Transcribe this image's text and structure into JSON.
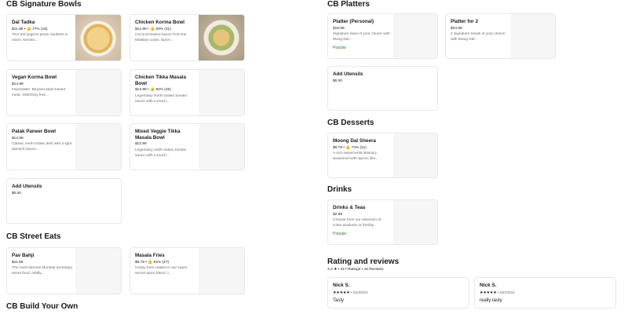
{
  "left_sections": {
    "signature_title": "CB Signature Bowls",
    "street_title": "CB Street Eats",
    "build_title": "CB Build Your Own"
  },
  "signature_items": [
    {
      "name": "Dal Tadka",
      "meta": "$11.99 • 👍 77% (18)",
      "desc": "Toor dal (pigeon peas) sauteed in onion, tomato..."
    },
    {
      "name": "Chicken Korma Bowl",
      "meta": "$12.99 • 👍 93% (31)",
      "desc": "Coconut-based sauce from the Malabar coast. Spice..."
    },
    {
      "name": "Vegan Korma Bowl",
      "meta": "$14.99",
      "desc": "Impossible: Beyond plant based meat, GMO/soy free..."
    },
    {
      "name": "Chicken Tikka Masala Bowl",
      "meta": "$13.99 • 👍 92% (26)",
      "desc": "Legendary North Indian tomato sauce with a touch..."
    },
    {
      "name": "Palak Paneer Bowl",
      "meta": "$13.99",
      "desc": "Classic north Indian dish with a light spinach sauce..."
    },
    {
      "name": "Mixed Veggie Tikka Masala Bowl",
      "meta": "$12.99",
      "desc": "Legendary north Indian tomato sauce with a touch..."
    },
    {
      "name": "Add Utensils",
      "meta": "$0.00",
      "desc": ""
    }
  ],
  "street_items": [
    {
      "name": "Pav Bahji",
      "meta": "$11.55",
      "desc": "The most famous Mumbai (bombay) street food: mildly..."
    },
    {
      "name": "Masala Fries",
      "meta": "$8.78 • 👍 62% (27)",
      "desc": "Crispy fries coated in our super secret spice blend, t..."
    }
  ],
  "right_sections": {
    "platters_title": "CB Platters",
    "desserts_title": "CB Desserts",
    "drinks_title": "Drinks"
  },
  "platters": [
    {
      "name": "Platter (Personal)",
      "meta": "$18.99",
      "desc": "Signature bowl of your choice with Moog Dal...",
      "badge": "Popular"
    },
    {
      "name": "Platter for 2",
      "meta": "$34.99",
      "desc": "2 Signature bowls of your choice with Moog Dal...",
      "badge": ""
    },
    {
      "name": "Add Utensils",
      "meta": "$0.00",
      "desc": "",
      "badge": ""
    }
  ],
  "desserts": [
    {
      "name": "Moong Dal Sheera",
      "meta": "$8.78 • 👍 72% (11)",
      "desc": "A rich sweet lentil delicacy seasoned with spices like..."
    }
  ],
  "drinks": [
    {
      "name": "Drinks & Teas",
      "meta": "$2.99",
      "desc": "Choose from our selection of Coke products or freshly...",
      "badge": "Popular"
    }
  ],
  "ratings": {
    "title": "Rating and reviews",
    "summary": "4.3 ★ • 317 Ratings • 15 Reviews",
    "reviews": [
      {
        "name": "Nick S.",
        "stars": "★★★★★",
        "date": "02/20/24",
        "text": "Tasty"
      },
      {
        "name": "Nick S.",
        "stars": "★★★★★",
        "date": "02/18/24",
        "text": "really tasty"
      }
    ]
  },
  "colors": {
    "popular": "#2e7d32",
    "border": "#e8e8e8",
    "thumb": "#f6f6f6"
  }
}
